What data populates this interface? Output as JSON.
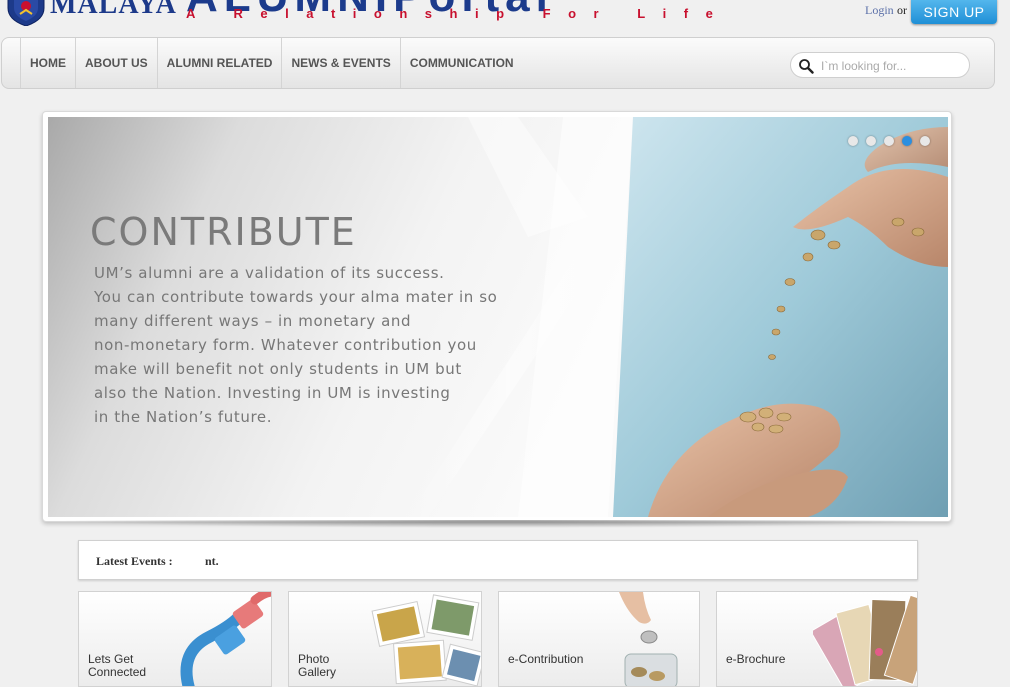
{
  "header": {
    "university_name": "MALAYA",
    "portal_title_part1": "ALUMNI",
    "portal_title_part2": "Portal",
    "tagline": "A Relationship For Life",
    "login_label": "Login",
    "or_label": "or",
    "signup_label": "SIGN UP"
  },
  "nav": {
    "items": [
      {
        "label": "HOME"
      },
      {
        "label": "ABOUT US"
      },
      {
        "label": "ALUMNI RELATED"
      },
      {
        "label": "NEWS & EVENTS"
      },
      {
        "label": "COMMUNICATION"
      }
    ],
    "search_placeholder": "I`m looking for..."
  },
  "slider": {
    "heading": "CONTRIBUTE",
    "lines": [
      "UM’s alumni are a validation of its success.",
      "You can contribute towards your alma mater in so",
      "many different ways – in monetary and",
      "non-monetary form. Whatever contribution you",
      "make will benefit not only students in UM but",
      "also the Nation. Investing in UM is investing",
      "in the Nation’s future."
    ],
    "dot_count": 5,
    "active_dot": 4
  },
  "events": {
    "label": "Latest Events :",
    "ticker": "nt."
  },
  "tiles": [
    {
      "line1": "Lets Get",
      "line2": "Connected"
    },
    {
      "line1": "Photo",
      "line2": "Gallery"
    },
    {
      "line1": "e-Contribution",
      "line2": ""
    },
    {
      "line1": "e-Brochure",
      "line2": ""
    }
  ],
  "colors": {
    "brand_blue": "#1c3b8c",
    "brand_red": "#c8102e",
    "signup_blue": "#1f8fd6",
    "active_dot": "#2b8fe0"
  }
}
